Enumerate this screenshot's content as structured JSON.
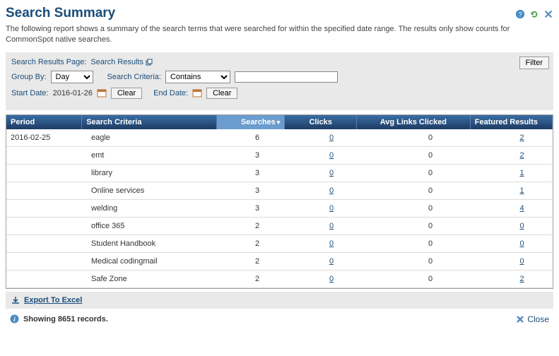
{
  "title": "Search Summary",
  "description": "The following report shows a summary of the search terms that were searched for within the specified date range. The results only show counts for CommonSpot native searches.",
  "filter": {
    "results_page_label": "Search Results Page:",
    "results_page_value": "Search Results",
    "group_by_label": "Group By:",
    "group_by_value": "Day",
    "criteria_label": "Search Criteria:",
    "criteria_mode": "Contains",
    "criteria_text": "",
    "start_date_label": "Start Date:",
    "start_date_value": "2016-01-26",
    "end_date_label": "End Date:",
    "clear_label": "Clear",
    "filter_button": "Filter"
  },
  "columns": {
    "period": "Period",
    "criteria": "Search Criteria",
    "searches": "Searches",
    "clicks": "Clicks",
    "avg": "Avg Links Clicked",
    "featured": "Featured Results"
  },
  "period_shown": "2016-02-25",
  "rows": [
    {
      "criteria": "eagle",
      "searches": "6",
      "clicks": "0",
      "avg": "0",
      "featured": "2"
    },
    {
      "criteria": "emt",
      "searches": "3",
      "clicks": "0",
      "avg": "0",
      "featured": "2"
    },
    {
      "criteria": "library",
      "searches": "3",
      "clicks": "0",
      "avg": "0",
      "featured": "1"
    },
    {
      "criteria": "Online services",
      "searches": "3",
      "clicks": "0",
      "avg": "0",
      "featured": "1"
    },
    {
      "criteria": "welding",
      "searches": "3",
      "clicks": "0",
      "avg": "0",
      "featured": "4"
    },
    {
      "criteria": "office 365",
      "searches": "2",
      "clicks": "0",
      "avg": "0",
      "featured": "0"
    },
    {
      "criteria": "Student Handbook",
      "searches": "2",
      "clicks": "0",
      "avg": "0",
      "featured": "0"
    },
    {
      "criteria": "Medical codingmail",
      "searches": "2",
      "clicks": "0",
      "avg": "0",
      "featured": "0"
    },
    {
      "criteria": "Safe Zone",
      "searches": "2",
      "clicks": "0",
      "avg": "0",
      "featured": "2"
    }
  ],
  "export_label": "Export To Excel",
  "status_text": "Showing 8651 records.",
  "close_label": "Close"
}
